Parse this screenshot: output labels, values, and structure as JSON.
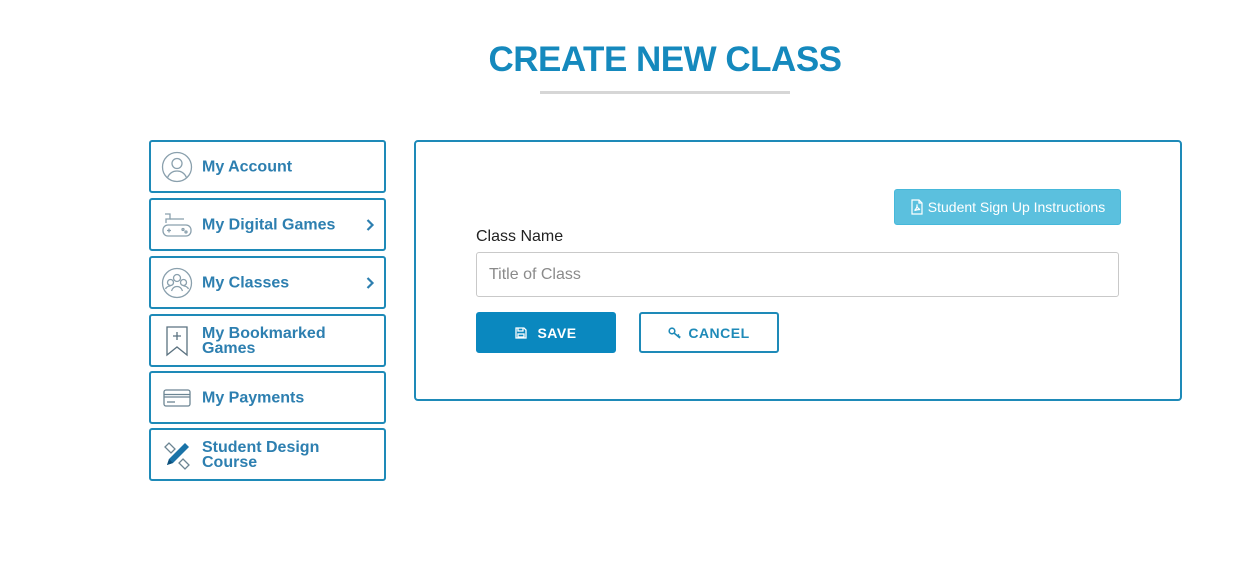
{
  "page": {
    "title": "CREATE NEW CLASS"
  },
  "sidebar": {
    "items": [
      {
        "label": "My Account",
        "icon": "user-circle-icon",
        "has_chevron": false
      },
      {
        "label": "My Digital Games",
        "icon": "gamepad-icon",
        "has_chevron": true
      },
      {
        "label": "My Classes",
        "icon": "group-icon",
        "has_chevron": true
      },
      {
        "label": "My Bookmarked Games",
        "icon": "bookmark-add-icon",
        "has_chevron": false
      },
      {
        "label": "My Payments",
        "icon": "credit-card-icon",
        "has_chevron": false
      },
      {
        "label": "Student Design Course",
        "icon": "design-tools-icon",
        "has_chevron": false
      }
    ]
  },
  "form": {
    "instructions_label": "Student Sign Up Instructions",
    "class_name_label": "Class Name",
    "class_name_value": "",
    "class_name_placeholder": "Title of Class",
    "save_label": "SAVE",
    "cancel_label": "CANCEL"
  },
  "colors": {
    "brand": "#1589bd",
    "primary_button": "#0a88bf",
    "info_button": "#5bc0de",
    "border": "#1e8ab8"
  }
}
